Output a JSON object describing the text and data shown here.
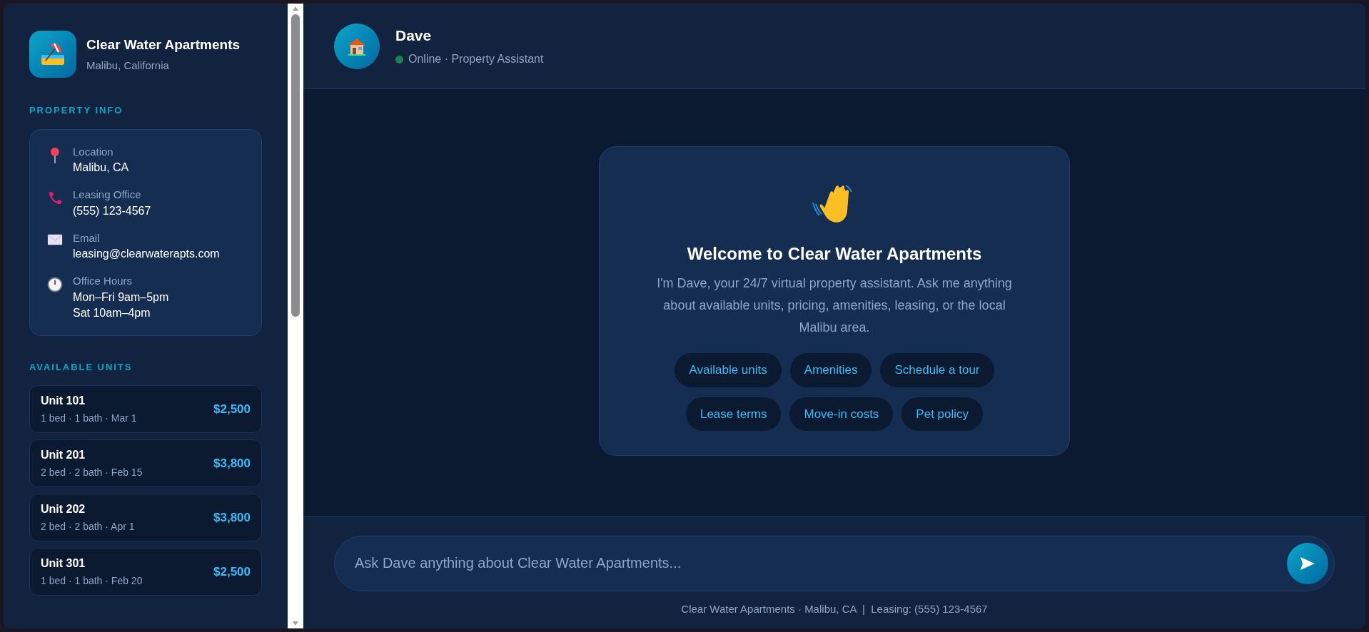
{
  "property": {
    "name": "Clear Water Apartments",
    "location": "Malibu, California"
  },
  "property_info": {
    "title": "PROPERTY INFO",
    "items": [
      {
        "kind": "pin",
        "label": "Location",
        "values": [
          "Malibu, CA"
        ]
      },
      {
        "kind": "phone",
        "label": "Leasing Office",
        "values": [
          "(555) 123-4567"
        ]
      },
      {
        "kind": "email",
        "label": "Email",
        "values": [
          "leasing@clearwaterapts.com"
        ]
      },
      {
        "kind": "clock",
        "label": "Office Hours",
        "values": [
          "Mon–Fri 9am–5pm",
          "Sat 10am–4pm"
        ]
      }
    ]
  },
  "available_units": {
    "title": "AVAILABLE UNITS",
    "units": [
      {
        "name": "Unit 101",
        "details": "1 bed · 1 bath · Mar 1",
        "price": "$2,500"
      },
      {
        "name": "Unit 201",
        "details": "2 bed · 2 bath · Feb 15",
        "price": "$3,800"
      },
      {
        "name": "Unit 202",
        "details": "2 bed · 2 bath · Apr 1",
        "price": "$3,800"
      },
      {
        "name": "Unit 301",
        "details": "1 bed · 1 bath · Feb 20",
        "price": "$2,500"
      }
    ]
  },
  "chat_header": {
    "name": "Dave",
    "online": true,
    "status": "Online · Property Assistant"
  },
  "welcome": {
    "title": "Welcome to Clear Water Apartments",
    "text": "I'm Dave, your 24/7 virtual property assistant. Ask me anything about available units, pricing, amenities, leasing, or the local Malibu area.",
    "suggestions": [
      "Available units",
      "Amenities",
      "Schedule a tour",
      "Lease terms",
      "Move-in costs",
      "Pet policy"
    ]
  },
  "composer": {
    "placeholder": "Ask Dave anything about Clear Water Apartments..."
  },
  "footer": "Clear Water Apartments · Malibu, CA  |  Leasing: (555) 123-4567"
}
